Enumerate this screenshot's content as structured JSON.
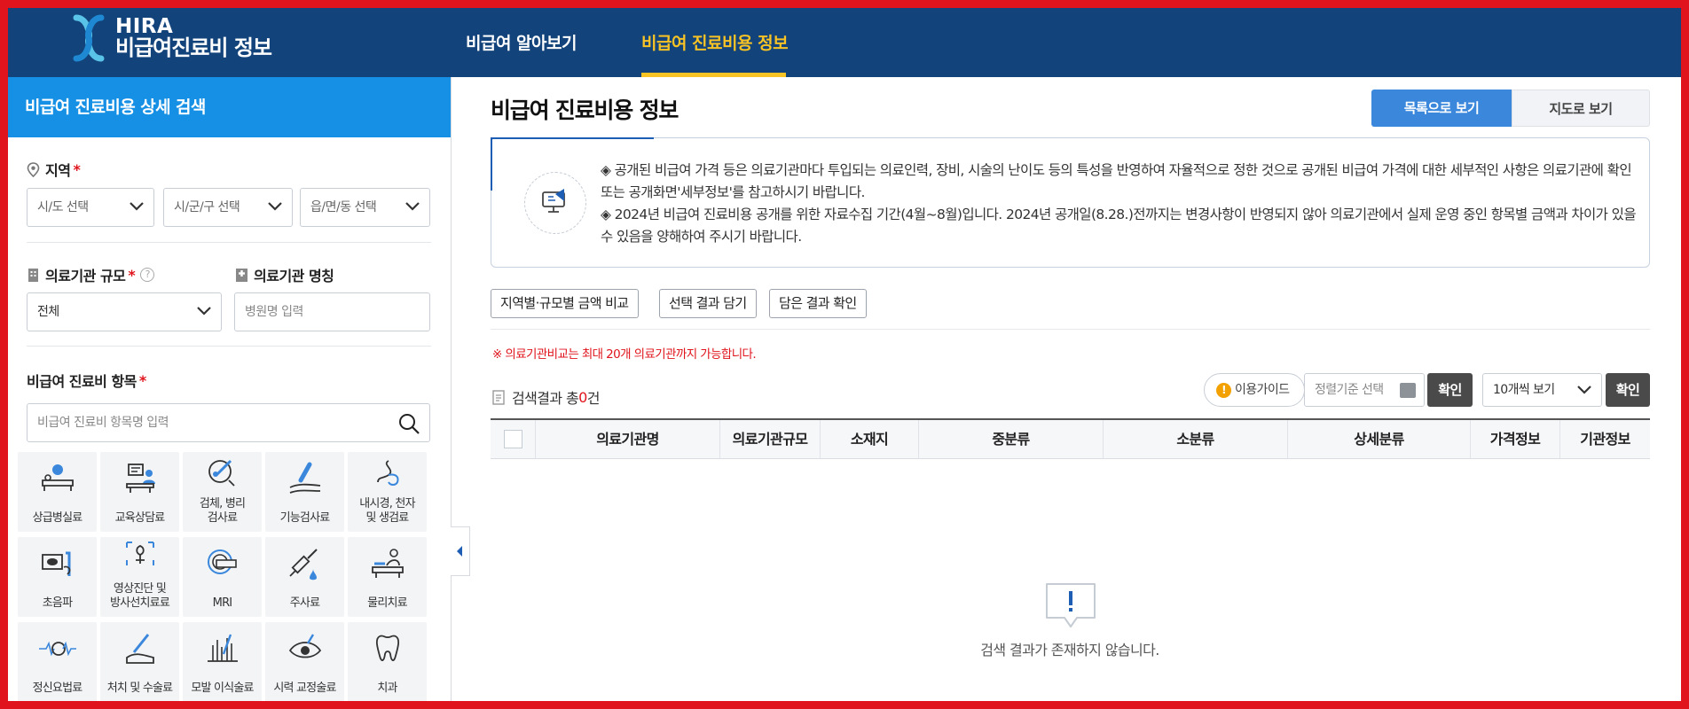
{
  "header": {
    "logo_hira": "HIRA",
    "logo_name": "비급여진료비 정보",
    "nav": [
      "비급여 알아보기",
      "비급여 진료비용 정보"
    ]
  },
  "sidebar": {
    "title": "비급여 진료비용 상세 검색",
    "region": {
      "label": "지역",
      "required": "*",
      "sido": "시/도 선택",
      "sigungu": "시/군/구 선택",
      "dong": "읍/면/동 선택"
    },
    "scale": {
      "label": "의료기관 규모",
      "required": "*",
      "help": "?",
      "value": "전체"
    },
    "name": {
      "label": "의료기관 명칭",
      "placeholder": "병원명 입력"
    },
    "items": {
      "label": "비급여 진료비 항목",
      "required": "*",
      "placeholder": "비급여 진료비 항목명 입력",
      "tiles": [
        "상급병실료",
        "교육상담료",
        "검체, 병리\n검사료",
        "기능검사료",
        "내시경, 천자\n및 생검료",
        "초음파",
        "영상진단 및\n방사선치료료",
        "MRI",
        "주사료",
        "물리치료",
        "정신요법료",
        "처치 및 수술료",
        "모발 이식술료",
        "시력 교정술료",
        "치과"
      ]
    }
  },
  "main": {
    "title": "비급여 진료비용 정보",
    "view_list": "목록으로 보기",
    "view_map": "지도로 보기",
    "notice": [
      "◈ 공개된 비급여 가격 등은 의료기관마다 투입되는 의료인력, 장비, 시술의 난이도 등의 특성을 반영하여 자율적으로 정한 것으로 공개된 비급여 가격에 대한 세부적인 사항은 의료기관에 확인 또는 공개화면'세부정보'를 참고하시기 바랍니다.",
      "◈ 2024년 비급여 진료비용 공개를 위한 자료수집 기간(4월~8월)입니다. 2024년 공개일(8.28.)전까지는 변경사항이 반영되지 않아 의료기관에서 실제 운영 중인 항목별 금액과 차이가 있을 수 있음을 양해하여 주시기 바랍니다."
    ],
    "actions": [
      "지역별·규모별 금액 비교",
      "선택 결과 담기",
      "담은 결과 확인"
    ],
    "warning": "※ 의료기관비교는 최대 20개 의료기관까지 가능합니다.",
    "result_prefix": "검색결과 총",
    "result_count": "0",
    "result_suffix": "건",
    "guide": "이용가이드",
    "sort_placeholder": "정렬기준 선택",
    "confirm": "확인",
    "per_page": "10개씩 보기",
    "columns": [
      "의료기관명",
      "의료기관규모",
      "소재지",
      "중분류",
      "소분류",
      "상세분류",
      "가격정보",
      "기관정보"
    ],
    "empty": "검색 결과가 존재하지 않습니다."
  },
  "colors": {
    "header_bg": "#12437a",
    "nav_active": "#f7c325",
    "sidebar_title_bg": "#1690e5",
    "primary_button": "#3a87dc",
    "required": "#e0141c",
    "dark_button": "#4a4a4a",
    "frame": "#e0141c"
  }
}
